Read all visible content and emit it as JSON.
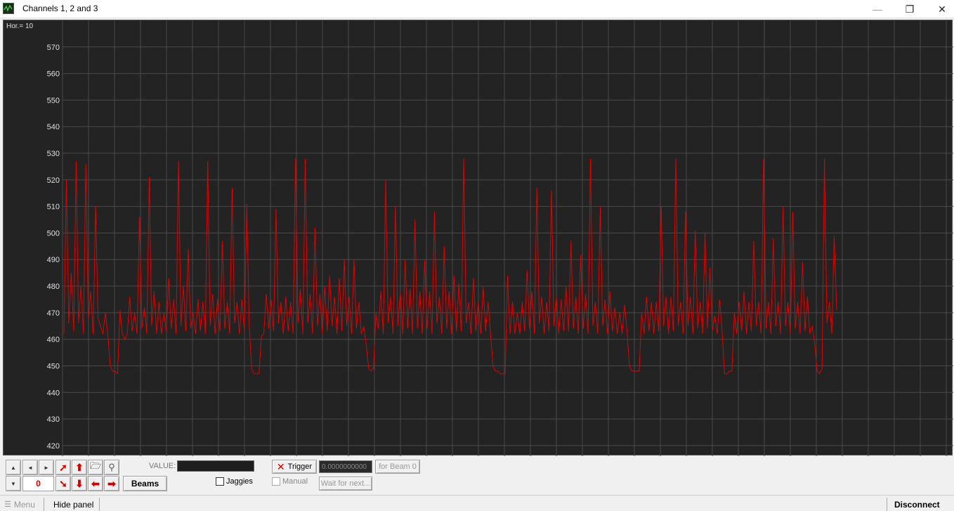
{
  "window": {
    "title": "Channels 1, 2 and 3",
    "minimize_icon": "—",
    "maximize_icon": "❐",
    "close_icon": "✕"
  },
  "plot": {
    "hor_label": "Hor.=  10",
    "background": "#232323",
    "grid_color": "#4a4a4a",
    "trace_color": "#e00000",
    "y_ticks": [
      "570",
      "560",
      "550",
      "540",
      "530",
      "520",
      "510",
      "500",
      "490",
      "480",
      "470",
      "460",
      "450",
      "440",
      "430",
      "420"
    ]
  },
  "chart_data": {
    "type": "line",
    "title": "",
    "xlabel": "",
    "ylabel": "",
    "ylim": [
      416,
      580
    ],
    "series": [
      {
        "values": [
          462,
          520,
          466,
          485,
          463,
          527,
          466,
          480,
          462,
          526,
          467,
          478,
          462,
          510,
          468,
          465,
          462,
          470,
          462,
          450,
          448,
          448,
          447,
          471,
          462,
          460,
          462,
          476,
          463,
          470,
          462,
          506,
          464,
          472,
          462,
          521,
          465,
          478,
          462,
          474,
          462,
          470,
          463,
          483,
          464,
          475,
          462,
          527,
          465,
          480,
          463,
          494,
          464,
          470,
          462,
          475,
          463,
          474,
          462,
          527,
          465,
          477,
          462,
          475,
          463,
          497,
          464,
          474,
          462,
          517,
          466,
          474,
          462,
          475,
          463,
          511,
          466,
          449,
          447,
          447,
          447,
          461,
          462,
          477,
          464,
          475,
          463,
          509,
          466,
          474,
          462,
          476,
          463,
          474,
          462,
          528,
          466,
          479,
          462,
          528,
          466,
          477,
          462,
          502,
          465,
          477,
          462,
          480,
          463,
          484,
          465,
          476,
          462,
          483,
          463,
          490,
          465,
          476,
          462,
          490,
          464,
          474,
          462,
          465,
          458,
          449,
          448,
          449,
          470,
          464,
          478,
          462,
          520,
          466,
          476,
          462,
          510,
          465,
          478,
          462,
          490,
          464,
          479,
          462,
          505,
          464,
          478,
          462,
          490,
          464,
          478,
          462,
          508,
          466,
          476,
          462,
          495,
          464,
          478,
          462,
          484,
          463,
          481,
          463,
          528,
          466,
          474,
          462,
          483,
          463,
          474,
          462,
          480,
          463,
          474,
          462,
          450,
          448,
          448,
          447,
          447,
          447,
          484,
          462,
          474,
          462,
          470,
          462,
          474,
          463,
          486,
          464,
          478,
          462,
          517,
          466,
          476,
          462,
          474,
          463,
          516,
          465,
          476,
          462,
          475,
          463,
          480,
          463,
          497,
          464,
          476,
          462,
          492,
          464,
          477,
          462,
          528,
          465,
          474,
          462,
          510,
          465,
          475,
          462,
          478,
          463,
          472,
          462,
          470,
          462,
          473,
          463,
          450,
          448,
          448,
          448,
          448,
          470,
          462,
          476,
          463,
          474,
          462,
          474,
          463,
          510,
          465,
          476,
          462,
          476,
          463,
          528,
          465,
          474,
          462,
          508,
          465,
          476,
          462,
          501,
          464,
          474,
          462,
          500,
          464,
          487,
          463,
          469,
          462,
          475,
          463,
          447,
          447,
          448,
          448,
          470,
          462,
          474,
          463,
          478,
          462,
          474,
          463,
          497,
          465,
          474,
          462,
          528,
          464,
          474,
          462,
          498,
          465,
          474,
          462,
          510,
          465,
          474,
          462,
          508,
          464,
          474,
          462,
          489,
          463,
          476,
          462,
          465,
          458,
          448,
          447,
          449,
          528,
          466,
          474,
          462,
          499,
          471
        ]
      }
    ]
  },
  "controls": {
    "scroll_up": "▲",
    "scroll_down": "▼",
    "left_arrow": "◄",
    "right_arrow": "►",
    "counter_value": "0",
    "beams_label": "Beams",
    "value_label": "VALUE:",
    "jaggies_label": "Jaggies",
    "manual_label": "Manual",
    "trigger_label": "Trigger",
    "trigger_value": "0.0000000000",
    "for_beam_label": "for Beam 0",
    "wait_label": "Wait for next..."
  },
  "statusbar": {
    "menu_label": "Menu",
    "hide_panel_label": "Hide panel",
    "disconnect_label": "Disconnect"
  }
}
